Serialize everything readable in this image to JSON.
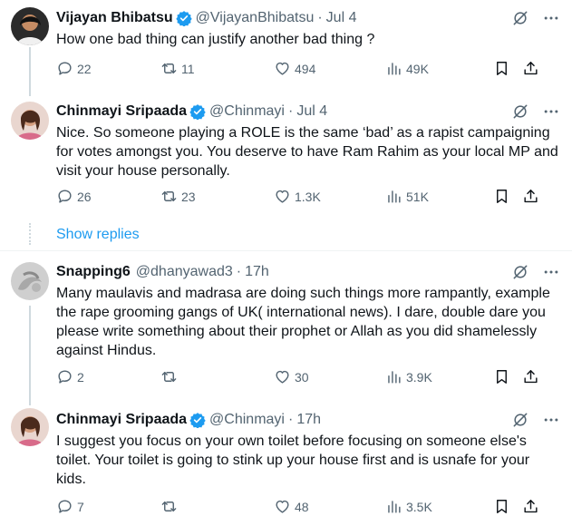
{
  "tweets": [
    {
      "name": "Vijayan Bhibatsu",
      "handle": "@VijayanBhibatsu",
      "sep": "·",
      "time": "Jul 4",
      "text": "How one bad thing can justify another bad thing ?",
      "stats": {
        "replies": "22",
        "retweets": "11",
        "likes": "494",
        "views": "49K"
      }
    },
    {
      "name": "Chinmayi Sripaada",
      "handle": "@Chinmayi",
      "sep": "·",
      "time": "Jul 4",
      "text": "Nice. So someone playing a ROLE is the same ‘bad’ as a rapist campaigning for votes amongst you. You deserve to have Ram Rahim as your local MP and visit your house personally.",
      "stats": {
        "replies": "26",
        "retweets": "23",
        "likes": "1.3K",
        "views": "51K"
      }
    },
    {
      "name": "Snapping6",
      "handle": "@dhanyawad3",
      "sep": "·",
      "time": "17h",
      "text": "Many maulavis and madrasa are doing such things more rampantly, example the rape grooming gangs of UK( international news). I dare, double dare you please write something about their prophet or Allah as you did shamelessly against Hindus.",
      "stats": {
        "replies": "2",
        "retweets": "",
        "likes": "30",
        "views": "3.9K"
      }
    },
    {
      "name": "Chinmayi Sripaada",
      "handle": "@Chinmayi",
      "sep": "·",
      "time": "17h",
      "text": "I suggest you focus on your own toilet before focusing on someone else's toilet. Your toilet is going to stink up your house first and is usnafe for your kids.",
      "stats": {
        "replies": "7",
        "retweets": "",
        "likes": "48",
        "views": "3.5K"
      }
    }
  ],
  "show_replies": "Show replies",
  "icons": [
    "verified-badge-icon",
    "grok-icon",
    "more-icon",
    "reply-icon",
    "retweet-icon",
    "like-icon",
    "views-icon",
    "bookmark-icon",
    "share-icon"
  ],
  "colors": {
    "accent": "#1d9bf0",
    "muted": "#536471",
    "text": "#0f1419",
    "line": "#cfd9de"
  }
}
